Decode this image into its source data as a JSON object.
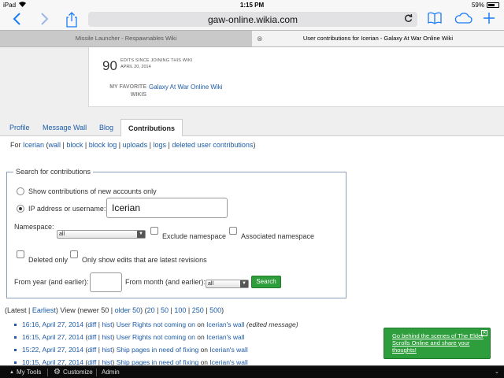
{
  "status_bar": {
    "device": "iPad",
    "time": "1:15 PM",
    "battery": "59%"
  },
  "browser": {
    "url": "gaw-online.wikia.com",
    "tabs": [
      {
        "title": "Missile Launcher - Respawnables Wiki",
        "active": false
      },
      {
        "title": "User contributions for Icerian - Galaxy At War Online Wiki",
        "active": true
      }
    ],
    "icons": [
      "back-icon",
      "forward-icon",
      "share-icon",
      "reload-icon",
      "bookmarks-icon",
      "cloud-tabs-icon",
      "new-tab-icon"
    ]
  },
  "profile": {
    "edit_count": "90",
    "edits_label": "EDITS SINCE JOINING THIS WIKI",
    "edits_date": "APRIL 20, 2014",
    "favorite_label": "MY FAVORITE WIKIS",
    "favorite_wiki": "Galaxy At War Online Wiki"
  },
  "profile_tabs": [
    "Profile",
    "Message Wall",
    "Blog",
    "Contributions"
  ],
  "for_line": {
    "prefix": "For ",
    "user": "Icerian",
    "links": [
      "wall",
      "block",
      "block log",
      "uploads",
      "logs",
      "deleted user contributions"
    ]
  },
  "search_form": {
    "legend": "Search for contributions",
    "radio_new_accounts": "Show contributions of new accounts only",
    "radio_ip": "IP address or username:",
    "username_value": "Icerian",
    "namespace_label": "Namespace:",
    "namespace_value": "all",
    "exclude_namespace": "Exclude namespace",
    "associated_namespace": "Associated namespace",
    "deleted_only": "Deleted only",
    "latest_only": "Only show edits that are latest revisions",
    "year_label": "From year (and earlier):",
    "month_label": "From month (and earlier):",
    "month_value": "all",
    "search_button": "Search"
  },
  "pager": {
    "text_a": "(Latest | ",
    "earliest": "Earliest",
    "text_b": ") View (newer 50 | ",
    "older": "older 50",
    "text_c": ") (",
    "sizes": [
      "20",
      "50",
      "100",
      "250",
      "500"
    ],
    "text_end": ")"
  },
  "contributions": [
    {
      "time": "16:16, April 27, 2014",
      "page": "User Rights not coming on",
      "wall": "Icerian's wall",
      "note": "(edited message)"
    },
    {
      "time": "16:15, April 27, 2014",
      "page": "User Rights not coming on",
      "wall": "Icerian's wall",
      "note": ""
    },
    {
      "time": "15:22, April 27, 2014",
      "page": "Ship pages in need of fixing",
      "wall": "Icerian's wall",
      "note": ""
    },
    {
      "time": "10:15, April 27, 2014",
      "page": "Ship pages in need of fixing",
      "wall": "Icerian's wall",
      "note": ""
    }
  ],
  "contrib_words": {
    "diff": "diff",
    "hist": "hist",
    "on": "on"
  },
  "promo": {
    "text": "Go behind the scenes of The Elder Scrolls Online and share your thoughts!"
  },
  "wikia_bar": {
    "my_tools": "My Tools",
    "customize": "Customize",
    "admin": "Admin"
  },
  "colors": {
    "link": "#1d5ca8",
    "search_button": "#2e9d3b",
    "safari_blue": "#1a7cf4",
    "bottom_bar": "#0b0b0b"
  }
}
